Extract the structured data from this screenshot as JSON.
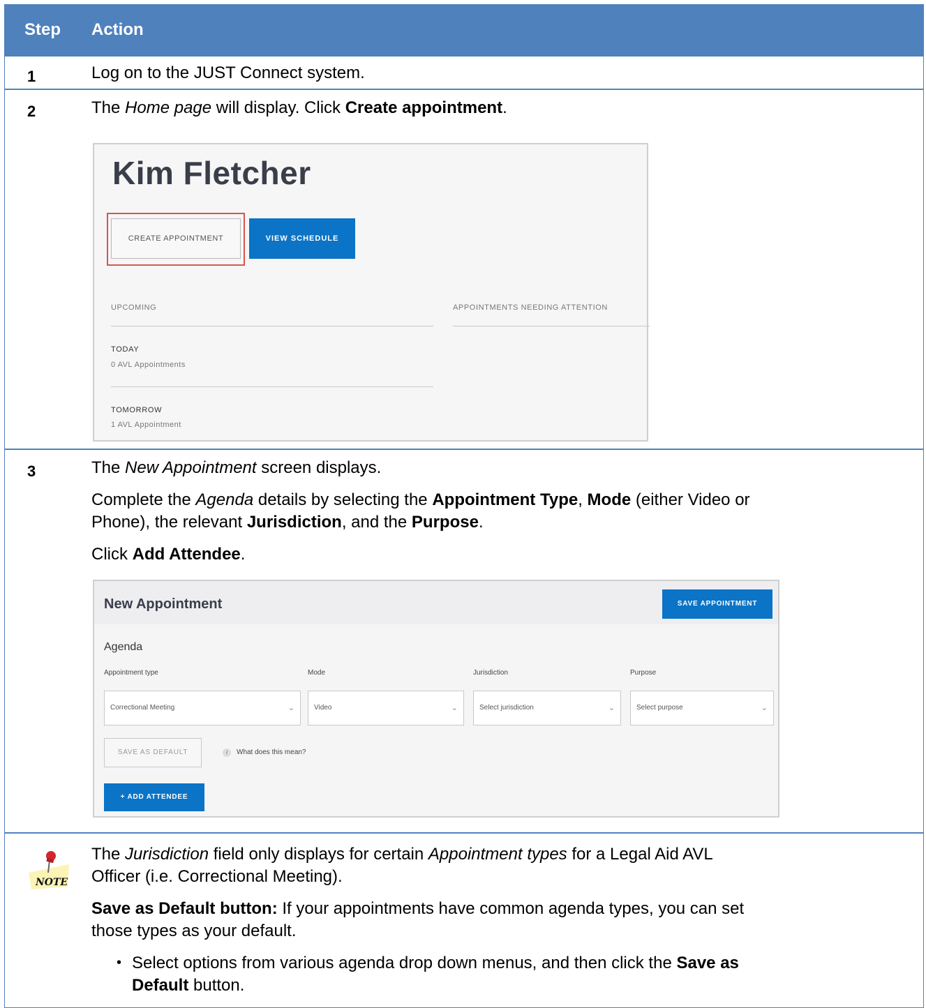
{
  "header": {
    "step": "Step",
    "action": "Action"
  },
  "row1": {
    "num": "1",
    "text": "Log on to the JUST Connect system."
  },
  "row2": {
    "num": "2",
    "t1": "The ",
    "t2": "Home page",
    "t3": " will display. Click ",
    "t4": "Create appointment",
    "t5": ".",
    "shot": {
      "name": "Kim Fletcher",
      "create_btn": "CREATE APPOINTMENT",
      "view_btn": "VIEW SCHEDULE",
      "upcoming": "UPCOMING",
      "attention": "APPOINTMENTS NEEDING ATTENTION",
      "today": "TODAY",
      "today_count": "0 AVL Appointments",
      "tomorrow": "TOMORROW",
      "tomorrow_count": "1 AVL Appointment",
      "highlight_color": "#d9534f"
    }
  },
  "row3": {
    "num": "3",
    "l1a": "The ",
    "l1b": "New Appointment",
    "l1c": " screen displays.",
    "l2a": "Complete the ",
    "l2b": "Agenda",
    "l2c": " details by selecting the ",
    "l2d": "Appointment Type",
    "l2e": ", ",
    "l2f": "Mode",
    "l2g": " (either Video or",
    "l3a": "Phone), the relevant ",
    "l3b": "Jurisdiction",
    "l3c": ", and the ",
    "l3d": "Purpose",
    "l3e": ".",
    "l4a": "Click ",
    "l4b": "Add Attendee",
    "l4c": ".",
    "shot": {
      "title": "New Appointment",
      "save_btn": "SAVE APPOINTMENT",
      "agenda": "Agenda",
      "labels": [
        "Appointment type",
        "Mode",
        "Jurisdiction",
        "Purpose"
      ],
      "values": [
        "Correctional Meeting",
        "Video",
        "Select jurisdiction",
        "Select purpose"
      ],
      "default_btn": "SAVE AS DEFAULT",
      "info_icon": "i",
      "info_text": "What does this mean?",
      "add_btn": "+ ADD ATTENDEE",
      "accent": "#0b74c6"
    }
  },
  "note": {
    "icon": "NOTE",
    "l1a": "The ",
    "l1b": "Jurisdiction",
    "l1c": " field only displays for certain ",
    "l1d": "Appointment types",
    "l1e": " for a Legal Aid AVL",
    "l2": "Officer (i.e. Correctional Meeting).",
    "l3a": "Save as Default button:",
    "l3b": " If your appointments have common agenda types, you can set",
    "l4": "those types as your default.",
    "bullet": "•",
    "l5a": "Select options from various agenda drop down menus, and then click the ",
    "l5b": "Save as",
    "l6a": "Default",
    "l6b": " button."
  },
  "colors": {
    "table_border": "#4f81bd",
    "header_bg": "#4f81bd"
  }
}
